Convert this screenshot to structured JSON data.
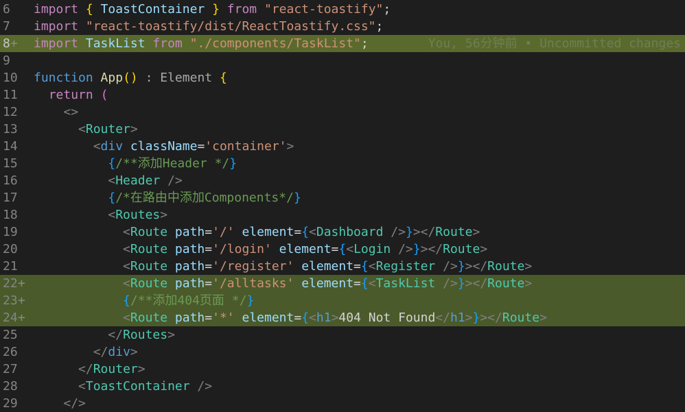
{
  "theme": {
    "background": "#1e1e1e",
    "added_line_bg": "#4b5a2a",
    "current_line_bg": "#5a6a2c"
  },
  "editor": {
    "blame": "You, 56分钟前 • Uncommitted changes",
    "lines": [
      {
        "num": "6",
        "mark": "",
        "state": "",
        "tokens": [
          {
            "t": "import",
            "c": "kw"
          },
          {
            "t": " ",
            "c": "txt"
          },
          {
            "t": "{",
            "c": "br1"
          },
          {
            "t": " ToastContainer ",
            "c": "var"
          },
          {
            "t": "}",
            "c": "br1"
          },
          {
            "t": " ",
            "c": "txt"
          },
          {
            "t": "from",
            "c": "kw"
          },
          {
            "t": " ",
            "c": "txt"
          },
          {
            "t": "\"react-toastify\"",
            "c": "str"
          },
          {
            "t": ";",
            "c": "txt"
          }
        ]
      },
      {
        "num": "7",
        "mark": "",
        "state": "",
        "tokens": [
          {
            "t": "import",
            "c": "kw"
          },
          {
            "t": " ",
            "c": "txt"
          },
          {
            "t": "\"react-toastify/dist/ReactToastify.css\"",
            "c": "str"
          },
          {
            "t": ";",
            "c": "txt"
          }
        ]
      },
      {
        "num": "8",
        "mark": "+",
        "state": "current",
        "tokens": [
          {
            "t": "import",
            "c": "kw"
          },
          {
            "t": " ",
            "c": "txt"
          },
          {
            "t": "TaskList",
            "c": "var"
          },
          {
            "t": " ",
            "c": "txt"
          },
          {
            "t": "from",
            "c": "kw"
          },
          {
            "t": " ",
            "c": "txt"
          },
          {
            "t": "\"./components/TaskList\"",
            "c": "str"
          },
          {
            "t": ";",
            "c": "txt"
          }
        ]
      },
      {
        "num": "9",
        "mark": "",
        "state": "",
        "tokens": []
      },
      {
        "num": "10",
        "mark": "",
        "state": "",
        "tokens": [
          {
            "t": "function",
            "c": "decl"
          },
          {
            "t": " ",
            "c": "txt"
          },
          {
            "t": "App",
            "c": "fn"
          },
          {
            "t": "()",
            "c": "br1"
          },
          {
            "t": " : Element ",
            "c": "hintbg"
          },
          {
            "t": "{",
            "c": "br1"
          }
        ]
      },
      {
        "num": "11",
        "mark": "",
        "state": "",
        "tokens": [
          {
            "t": "  ",
            "c": "txt"
          },
          {
            "t": "return",
            "c": "kw"
          },
          {
            "t": " ",
            "c": "txt"
          },
          {
            "t": "(",
            "c": "br2"
          }
        ]
      },
      {
        "num": "12",
        "mark": "",
        "state": "",
        "tokens": [
          {
            "t": "    ",
            "c": "txt"
          },
          {
            "t": "<>",
            "c": "ang"
          }
        ]
      },
      {
        "num": "13",
        "mark": "",
        "state": "",
        "tokens": [
          {
            "t": "      ",
            "c": "txt"
          },
          {
            "t": "<",
            "c": "ang"
          },
          {
            "t": "Router",
            "c": "tag"
          },
          {
            "t": ">",
            "c": "ang"
          }
        ]
      },
      {
        "num": "14",
        "mark": "",
        "state": "",
        "tokens": [
          {
            "t": "        ",
            "c": "txt"
          },
          {
            "t": "<",
            "c": "ang"
          },
          {
            "t": "div",
            "c": "decl"
          },
          {
            "t": " ",
            "c": "txt"
          },
          {
            "t": "className",
            "c": "var"
          },
          {
            "t": "=",
            "c": "txt"
          },
          {
            "t": "'container'",
            "c": "str"
          },
          {
            "t": ">",
            "c": "ang"
          }
        ]
      },
      {
        "num": "15",
        "mark": "",
        "state": "",
        "tokens": [
          {
            "t": "          ",
            "c": "txt"
          },
          {
            "t": "{",
            "c": "br3"
          },
          {
            "t": "/**添加Header */",
            "c": "cmt"
          },
          {
            "t": "}",
            "c": "br3"
          }
        ]
      },
      {
        "num": "16",
        "mark": "",
        "state": "",
        "tokens": [
          {
            "t": "          ",
            "c": "txt"
          },
          {
            "t": "<",
            "c": "ang"
          },
          {
            "t": "Header",
            "c": "tag"
          },
          {
            "t": " />",
            "c": "ang"
          }
        ]
      },
      {
        "num": "17",
        "mark": "",
        "state": "",
        "tokens": [
          {
            "t": "          ",
            "c": "txt"
          },
          {
            "t": "{",
            "c": "br3"
          },
          {
            "t": "/*在路由中添加Components*/",
            "c": "cmt"
          },
          {
            "t": "}",
            "c": "br3"
          }
        ]
      },
      {
        "num": "18",
        "mark": "",
        "state": "",
        "tokens": [
          {
            "t": "          ",
            "c": "txt"
          },
          {
            "t": "<",
            "c": "ang"
          },
          {
            "t": "Routes",
            "c": "tag"
          },
          {
            "t": ">",
            "c": "ang"
          }
        ]
      },
      {
        "num": "19",
        "mark": "",
        "state": "",
        "tokens": [
          {
            "t": "            ",
            "c": "txt"
          },
          {
            "t": "<",
            "c": "ang"
          },
          {
            "t": "Route",
            "c": "tag"
          },
          {
            "t": " ",
            "c": "txt"
          },
          {
            "t": "path",
            "c": "var"
          },
          {
            "t": "=",
            "c": "txt"
          },
          {
            "t": "'/'",
            "c": "str"
          },
          {
            "t": " ",
            "c": "txt"
          },
          {
            "t": "element",
            "c": "var"
          },
          {
            "t": "=",
            "c": "txt"
          },
          {
            "t": "{",
            "c": "br3"
          },
          {
            "t": "<",
            "c": "ang"
          },
          {
            "t": "Dashboard",
            "c": "tag"
          },
          {
            "t": " />",
            "c": "ang"
          },
          {
            "t": "}",
            "c": "br3"
          },
          {
            "t": "></",
            "c": "ang"
          },
          {
            "t": "Route",
            "c": "tag"
          },
          {
            "t": ">",
            "c": "ang"
          }
        ]
      },
      {
        "num": "20",
        "mark": "",
        "state": "",
        "tokens": [
          {
            "t": "            ",
            "c": "txt"
          },
          {
            "t": "<",
            "c": "ang"
          },
          {
            "t": "Route",
            "c": "tag"
          },
          {
            "t": " ",
            "c": "txt"
          },
          {
            "t": "path",
            "c": "var"
          },
          {
            "t": "=",
            "c": "txt"
          },
          {
            "t": "'/login'",
            "c": "str"
          },
          {
            "t": " ",
            "c": "txt"
          },
          {
            "t": "element",
            "c": "var"
          },
          {
            "t": "=",
            "c": "txt"
          },
          {
            "t": "{",
            "c": "br3"
          },
          {
            "t": "<",
            "c": "ang"
          },
          {
            "t": "Login",
            "c": "tag"
          },
          {
            "t": " />",
            "c": "ang"
          },
          {
            "t": "}",
            "c": "br3"
          },
          {
            "t": "></",
            "c": "ang"
          },
          {
            "t": "Route",
            "c": "tag"
          },
          {
            "t": ">",
            "c": "ang"
          }
        ]
      },
      {
        "num": "21",
        "mark": "",
        "state": "",
        "tokens": [
          {
            "t": "            ",
            "c": "txt"
          },
          {
            "t": "<",
            "c": "ang"
          },
          {
            "t": "Route",
            "c": "tag"
          },
          {
            "t": " ",
            "c": "txt"
          },
          {
            "t": "path",
            "c": "var"
          },
          {
            "t": "=",
            "c": "txt"
          },
          {
            "t": "'/register'",
            "c": "str"
          },
          {
            "t": " ",
            "c": "txt"
          },
          {
            "t": "element",
            "c": "var"
          },
          {
            "t": "=",
            "c": "txt"
          },
          {
            "t": "{",
            "c": "br3"
          },
          {
            "t": "<",
            "c": "ang"
          },
          {
            "t": "Register",
            "c": "tag"
          },
          {
            "t": " />",
            "c": "ang"
          },
          {
            "t": "}",
            "c": "br3"
          },
          {
            "t": "></",
            "c": "ang"
          },
          {
            "t": "Route",
            "c": "tag"
          },
          {
            "t": ">",
            "c": "ang"
          }
        ]
      },
      {
        "num": "22",
        "mark": "+",
        "state": "added",
        "tokens": [
          {
            "t": "            ",
            "c": "txt"
          },
          {
            "t": "<",
            "c": "ang"
          },
          {
            "t": "Route",
            "c": "tag"
          },
          {
            "t": " ",
            "c": "txt"
          },
          {
            "t": "path",
            "c": "var"
          },
          {
            "t": "=",
            "c": "txt"
          },
          {
            "t": "'/alltasks'",
            "c": "str"
          },
          {
            "t": " ",
            "c": "txt"
          },
          {
            "t": "element",
            "c": "var"
          },
          {
            "t": "=",
            "c": "txt"
          },
          {
            "t": "{",
            "c": "br3"
          },
          {
            "t": "<",
            "c": "ang"
          },
          {
            "t": "TaskList",
            "c": "tag"
          },
          {
            "t": " />",
            "c": "ang"
          },
          {
            "t": "}",
            "c": "br3"
          },
          {
            "t": "></",
            "c": "ang"
          },
          {
            "t": "Route",
            "c": "tag"
          },
          {
            "t": ">",
            "c": "ang"
          }
        ]
      },
      {
        "num": "23",
        "mark": "+",
        "state": "added",
        "tokens": [
          {
            "t": "            ",
            "c": "txt"
          },
          {
            "t": "{",
            "c": "br3"
          },
          {
            "t": "/**添加404页面 */",
            "c": "cmt"
          },
          {
            "t": "}",
            "c": "br3"
          }
        ]
      },
      {
        "num": "24",
        "mark": "+",
        "state": "added",
        "tokens": [
          {
            "t": "            ",
            "c": "txt"
          },
          {
            "t": "<",
            "c": "ang"
          },
          {
            "t": "Route",
            "c": "tag"
          },
          {
            "t": " ",
            "c": "txt"
          },
          {
            "t": "path",
            "c": "var"
          },
          {
            "t": "=",
            "c": "txt"
          },
          {
            "t": "'*'",
            "c": "str"
          },
          {
            "t": " ",
            "c": "txt"
          },
          {
            "t": "element",
            "c": "var"
          },
          {
            "t": "=",
            "c": "txt"
          },
          {
            "t": "{",
            "c": "br3"
          },
          {
            "t": "<",
            "c": "ang"
          },
          {
            "t": "h1",
            "c": "decl"
          },
          {
            "t": ">",
            "c": "ang"
          },
          {
            "t": "404 Not Found",
            "c": "txt"
          },
          {
            "t": "</",
            "c": "ang"
          },
          {
            "t": "h1",
            "c": "decl"
          },
          {
            "t": ">",
            "c": "ang"
          },
          {
            "t": "}",
            "c": "br3"
          },
          {
            "t": "></",
            "c": "ang"
          },
          {
            "t": "Route",
            "c": "tag"
          },
          {
            "t": ">",
            "c": "ang"
          }
        ]
      },
      {
        "num": "25",
        "mark": "",
        "state": "",
        "tokens": [
          {
            "t": "          ",
            "c": "txt"
          },
          {
            "t": "</",
            "c": "ang"
          },
          {
            "t": "Routes",
            "c": "tag"
          },
          {
            "t": ">",
            "c": "ang"
          }
        ]
      },
      {
        "num": "26",
        "mark": "",
        "state": "",
        "tokens": [
          {
            "t": "        ",
            "c": "txt"
          },
          {
            "t": "</",
            "c": "ang"
          },
          {
            "t": "div",
            "c": "decl"
          },
          {
            "t": ">",
            "c": "ang"
          }
        ]
      },
      {
        "num": "27",
        "mark": "",
        "state": "",
        "tokens": [
          {
            "t": "      ",
            "c": "txt"
          },
          {
            "t": "</",
            "c": "ang"
          },
          {
            "t": "Router",
            "c": "tag"
          },
          {
            "t": ">",
            "c": "ang"
          }
        ]
      },
      {
        "num": "28",
        "mark": "",
        "state": "",
        "tokens": [
          {
            "t": "      ",
            "c": "txt"
          },
          {
            "t": "<",
            "c": "ang"
          },
          {
            "t": "ToastContainer",
            "c": "tag"
          },
          {
            "t": " />",
            "c": "ang"
          }
        ]
      },
      {
        "num": "29",
        "mark": "",
        "state": "",
        "tokens": [
          {
            "t": "    ",
            "c": "txt"
          },
          {
            "t": "</>",
            "c": "ang"
          }
        ]
      }
    ]
  }
}
